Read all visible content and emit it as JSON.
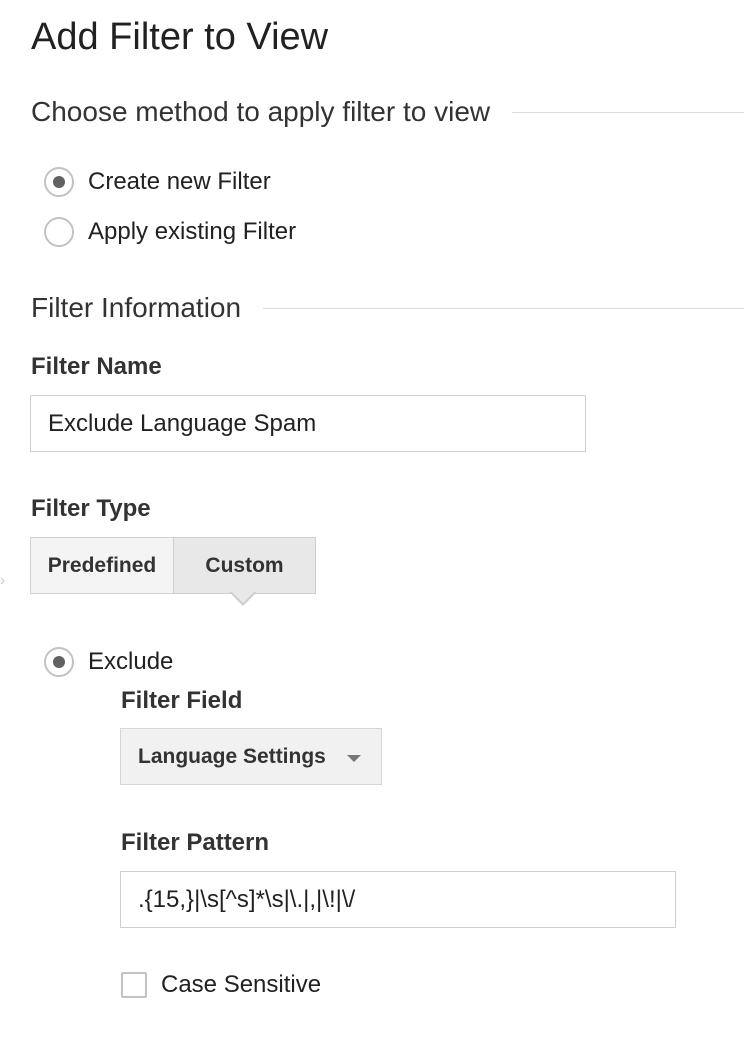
{
  "page": {
    "title": "Add Filter to View"
  },
  "method_section": {
    "heading": "Choose method to apply filter to view",
    "options": [
      {
        "label": "Create new Filter",
        "selected": true
      },
      {
        "label": "Apply existing Filter",
        "selected": false
      }
    ]
  },
  "info_section": {
    "heading": "Filter Information",
    "filter_name": {
      "label": "Filter Name",
      "value": "Exclude Language Spam"
    },
    "filter_type": {
      "label": "Filter Type",
      "tabs": [
        {
          "label": "Predefined",
          "active": false
        },
        {
          "label": "Custom",
          "active": true
        }
      ]
    },
    "mode": {
      "label": "Exclude",
      "selected": true
    },
    "filter_field": {
      "label": "Filter Field",
      "selected": "Language Settings"
    },
    "filter_pattern": {
      "label": "Filter Pattern",
      "value": ".{15,}|\\s[^s]*\\s|\\.|,|\\!|\\/"
    },
    "case_sensitive": {
      "label": "Case Sensitive",
      "checked": false
    }
  }
}
